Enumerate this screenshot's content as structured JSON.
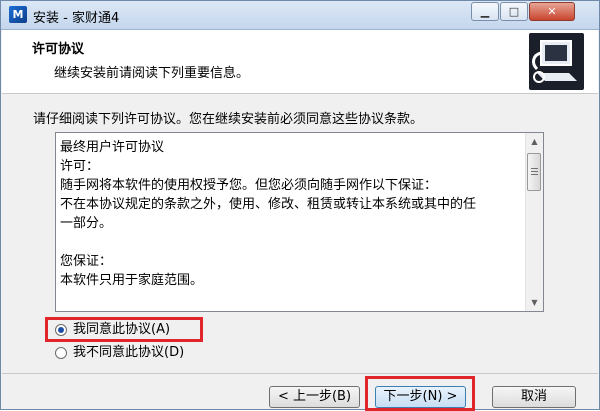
{
  "window": {
    "title": "安装 - 家财通4",
    "icon_name": "installer-app-icon",
    "icon_glyph": "M",
    "minimize_glyph": "▁",
    "maximize_glyph": "□",
    "close_glyph": "✕"
  },
  "header": {
    "title": "许可协议",
    "subtitle": "继续安装前请阅读下列重要信息。",
    "logo_icon": "computer-install-icon"
  },
  "instruction": "请仔细阅读下列许可协议。您在继续安装前必须同意这些协议条款。",
  "license": {
    "lines": [
      "最终用户许可协议",
      "许可：",
      "随手网将本软件的使用权授予您。但您必须向随手网作以下保证：",
      "不在本协议规定的条款之外，使用、修改、租赁或转让本系统或其中的任",
      "一部分。",
      "",
      "您保证：",
      "本软件只用于家庭范围。"
    ]
  },
  "options": {
    "accept_label": "我同意此协议(A)",
    "decline_label": "我不同意此协议(D)",
    "selected": "accept"
  },
  "buttons": {
    "back_label": "< 上一步(B)",
    "next_label": "下一步(N) >",
    "cancel_label": "取消"
  },
  "colors": {
    "highlight": "#e0262a",
    "radio_dot": "#1e4fa8"
  }
}
